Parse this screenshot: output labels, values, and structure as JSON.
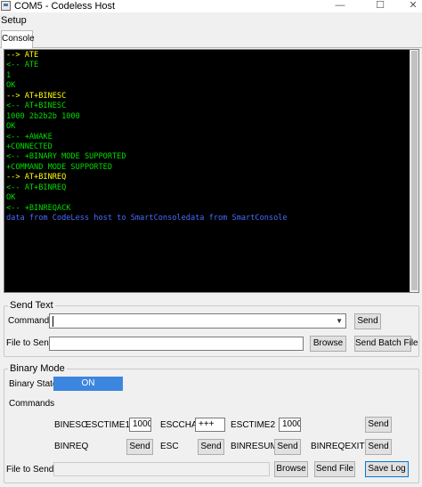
{
  "window": {
    "title": "COM5 - Codeless Host",
    "controls": {
      "minimize": "—",
      "maximize": "☐",
      "close": "✕"
    }
  },
  "menu": {
    "setup": "Setup"
  },
  "tabs": [
    {
      "label": "Console"
    }
  ],
  "console": {
    "colors": {
      "sent": "#ffff00",
      "received": "#00dd00",
      "data": "#4a6cff"
    },
    "lines": [
      {
        "text": "--> ATE",
        "kind": "sent"
      },
      {
        "text": "<-- ATE",
        "kind": "received"
      },
      {
        "text": "1",
        "kind": "received"
      },
      {
        "text": "OK",
        "kind": "received"
      },
      {
        "text": "--> AT+BINESC",
        "kind": "sent"
      },
      {
        "text": "<-- AT+BINESC",
        "kind": "received"
      },
      {
        "text": "1000 2b2b2b 1000",
        "kind": "received"
      },
      {
        "text": "OK",
        "kind": "received"
      },
      {
        "text": "<-- +AWAKE",
        "kind": "received"
      },
      {
        "text": "+CONNECTED",
        "kind": "received"
      },
      {
        "text": "<-- +BINARY MODE SUPPORTED",
        "kind": "received"
      },
      {
        "text": "+COMMAND MODE SUPPORTED",
        "kind": "received"
      },
      {
        "text": "--> AT+BINREQ",
        "kind": "sent"
      },
      {
        "text": "<-- AT+BINREQ",
        "kind": "received"
      },
      {
        "text": "OK",
        "kind": "received"
      },
      {
        "text": "<-- +BINREQACK",
        "kind": "received"
      },
      {
        "text": "data from CodeLess host to SmartConsoledata from SmartConsole",
        "kind": "data"
      }
    ]
  },
  "send_text": {
    "title": "Send Text",
    "command_label": "Command",
    "command_value": "",
    "send_label": "Send",
    "file_label": "File to Send",
    "file_value": "",
    "browse_label": "Browse",
    "send_batch_label": "Send Batch File"
  },
  "binary": {
    "title": "Binary Mode",
    "state_label": "Binary State",
    "state_value": "ON",
    "commands_label": "Commands",
    "binesc_label": "BINESC",
    "esctime1_label": "ESCTIME1",
    "esctime1_value": "1000",
    "escchar_label": "ESCCHAR",
    "escchar_value": "+++",
    "esctime2_label": "ESCTIME2",
    "esctime2_value": "1000",
    "binesc_send": "Send",
    "binreq_label": "BINREQ",
    "binreq_send": "Send",
    "esc_label": "ESC",
    "esc_send": "Send",
    "binresume_label": "BINRESUME",
    "binresume_send": "Send",
    "binreqexit_label": "BINREQEXIT",
    "binreqexit_send": "Send",
    "file_label": "File to Send",
    "file_value": "",
    "browse_label": "Browse",
    "send_file_label": "Send File",
    "save_log_label": "Save Log"
  }
}
